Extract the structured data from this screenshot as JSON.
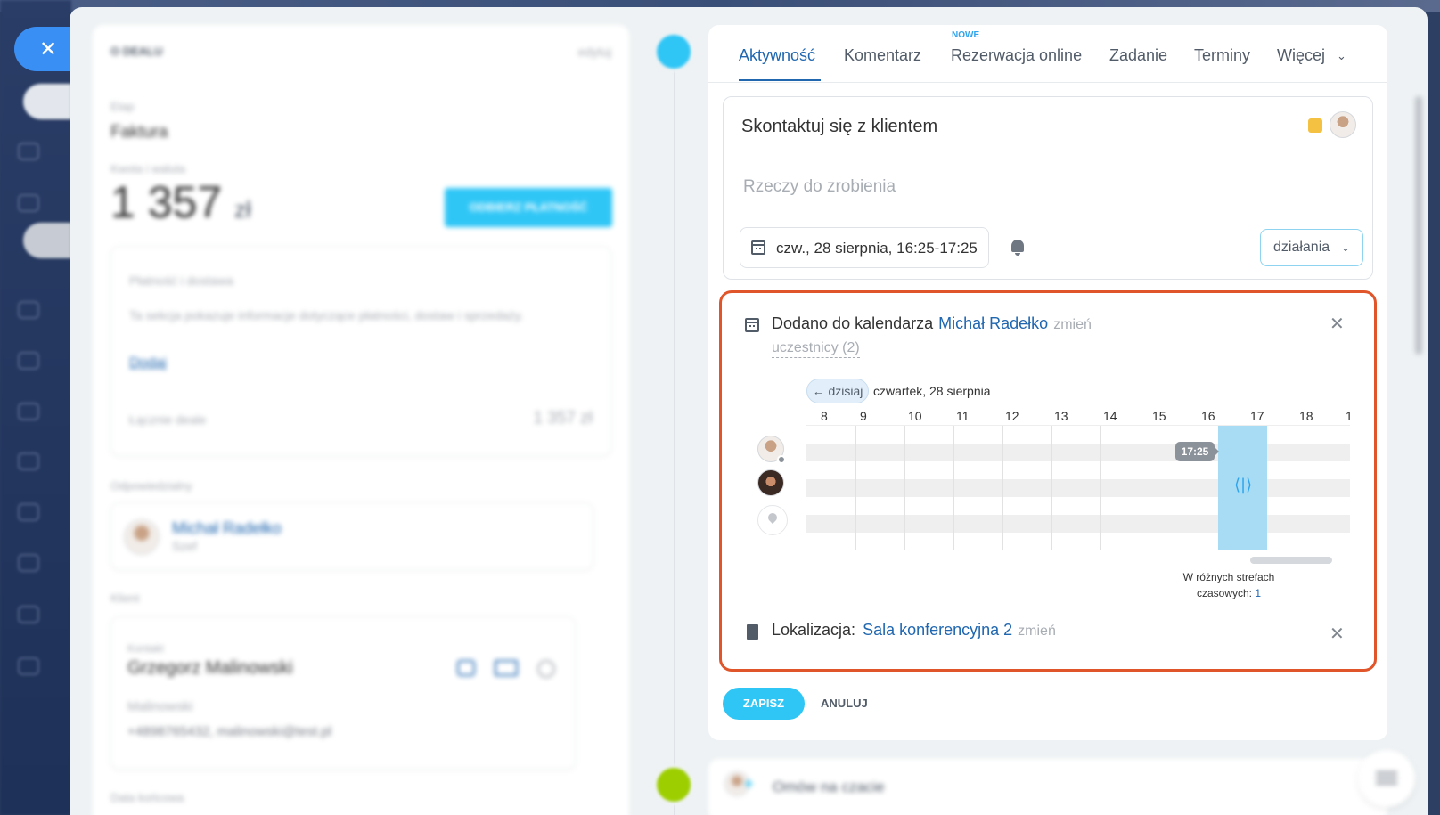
{
  "deal": {
    "title": "O DEALU",
    "edit": "edytuj",
    "stage_label": "Etap",
    "stage_value": "Faktura",
    "amount_label": "Kwota i waluta",
    "amount_value": "1 357",
    "amount_currency": "zł",
    "pay_button": "ODBIERZ PŁATNOŚĆ",
    "payment_title": "Płatność i dostawa",
    "payment_desc": "Ta sekcja pokazuje informacje dotyczące płatności, dostaw i sprzedaży.",
    "payment_add": "Dodaj",
    "total_label": "Łącznie deale",
    "total_value": "1 357 zł",
    "responsible_label": "Odpowiedzialny",
    "responsible_name": "Michał Radełko",
    "responsible_role": "Szef",
    "client_label": "Klient",
    "contact_label": "Kontakt",
    "contact_name": "Grzegorz Malinowski",
    "contact_company": "Malinowski",
    "contact_details": "+4898765432, malinowski@test.pl",
    "end_date_label": "Data końcowa"
  },
  "tabs": [
    {
      "label": "Aktywność",
      "active": true
    },
    {
      "label": "Komentarz"
    },
    {
      "label": "Rezerwacja online",
      "badge": "NOWE"
    },
    {
      "label": "Zadanie"
    },
    {
      "label": "Terminy"
    },
    {
      "label": "Więcej"
    }
  ],
  "todo": {
    "title": "Skontaktuj się z klientem",
    "placeholder": "Rzeczy do zrobienia",
    "date": "czw., 28 sierpnia, 16:25-17:25",
    "actions": "działania",
    "color": "#f5c142"
  },
  "calendar": {
    "added_text": "Dodano do kalendarza",
    "owner": "Michał Radełko",
    "change": "zmień",
    "participants": "uczestnicy (2)",
    "today_btn": "← dzisiaj",
    "day_label": "czwartek, 28 sierpnia",
    "hours": [
      "8",
      "9",
      "10",
      "11",
      "12",
      "13",
      "14",
      "15",
      "16",
      "17",
      "18",
      "1"
    ],
    "now_time": "17:25",
    "timezone_text": "W różnych strefach czasowych:",
    "timezone_count": "1",
    "location_label": "Lokalizacja:",
    "location_value": "Sala konferencyjna 2",
    "location_change": "zmień"
  },
  "buttons": {
    "save": "ZAPISZ",
    "cancel": "ANULUJ"
  },
  "chat": {
    "placeholder": "Omów na czacie"
  },
  "colors": {
    "accent": "#2067b0",
    "primary_button": "#2fc6f6",
    "highlight_border": "#e0552a"
  }
}
